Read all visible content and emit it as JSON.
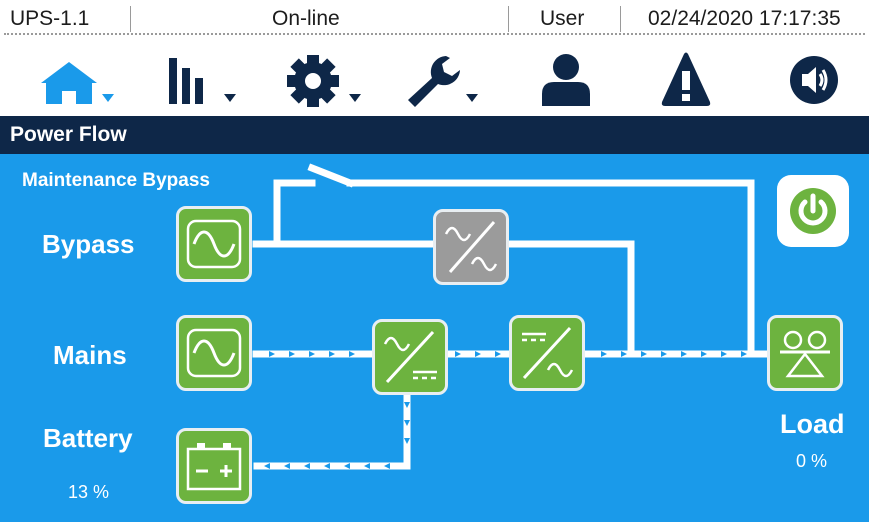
{
  "status_bar": {
    "device": "UPS-1.1",
    "mode": "On-line",
    "user": "User",
    "datetime": "02/24/2020  17:17:35"
  },
  "nav": {
    "icons": [
      "home-icon",
      "bar-chart-icon",
      "gear-icon",
      "wrench-icon",
      "user-icon",
      "warning-icon",
      "speaker-icon"
    ],
    "active": "home-icon",
    "colors": {
      "active": "#1a9aea",
      "inactive": "#0e2748"
    }
  },
  "section": {
    "title": "Power Flow"
  },
  "power_flow": {
    "maintenance_bypass_label": "Maintenance Bypass",
    "bypass_label": "Bypass",
    "mains_label": "Mains",
    "battery_label": "Battery",
    "battery_value": "13 %",
    "load_label": "Load",
    "load_value": "0 %",
    "colors": {
      "panel": "#1a9aea",
      "active_block": "#6db33f",
      "inactive_block": "#9b9b9b",
      "line": "#ffffff",
      "arrow": "#1a9aea"
    }
  }
}
